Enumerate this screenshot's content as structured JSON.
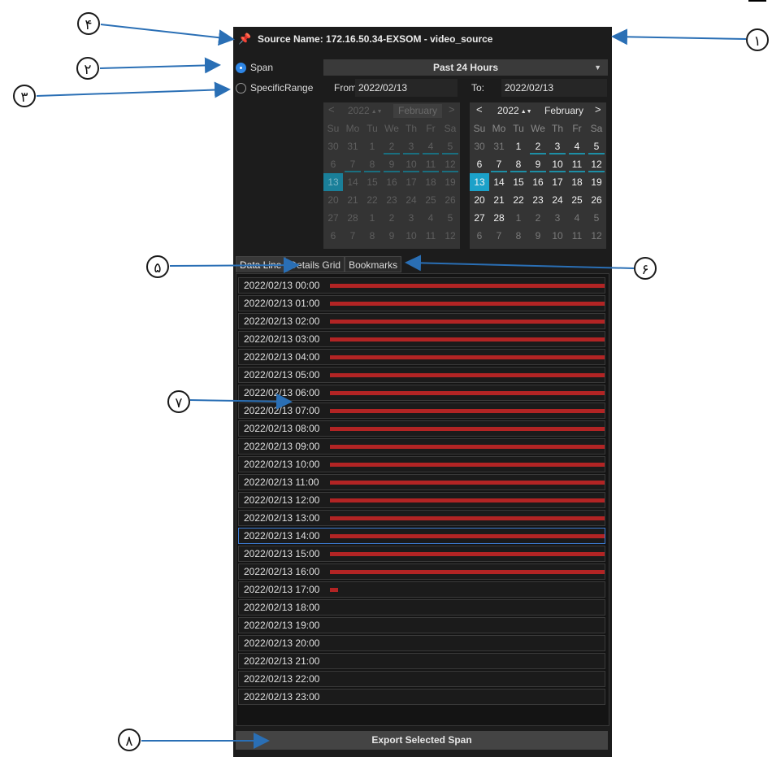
{
  "source": {
    "title": "Source Name: 172.16.50.34-EXSOM - video_source",
    "icon": "pin-icon"
  },
  "range": {
    "span_label": "Span",
    "specific_label": "SpecificRange",
    "selected": "span",
    "span_value": "Past 24 Hours",
    "from_label": "From:",
    "from_value": "2022/02/13",
    "to_label": "To:",
    "to_value": "2022/02/13"
  },
  "calendar_from": {
    "prev": "<",
    "next": ">",
    "year": "2022",
    "month": "February",
    "weekdays": [
      "Su",
      "Mo",
      "Tu",
      "We",
      "Th",
      "Fr",
      "Sa"
    ],
    "weeks": [
      [
        "30",
        "31",
        "1",
        "2",
        "3",
        "4",
        "5"
      ],
      [
        "6",
        "7",
        "8",
        "9",
        "10",
        "11",
        "12"
      ],
      [
        "13",
        "14",
        "15",
        "16",
        "17",
        "18",
        "19"
      ],
      [
        "20",
        "21",
        "22",
        "23",
        "24",
        "25",
        "26"
      ],
      [
        "27",
        "28",
        "1",
        "2",
        "3",
        "4",
        "5"
      ],
      [
        "6",
        "7",
        "8",
        "9",
        "10",
        "11",
        "12"
      ]
    ],
    "selected_day": "13"
  },
  "calendar_to": {
    "prev": "<",
    "next": ">",
    "year": "2022",
    "month": "February",
    "weekdays": [
      "Su",
      "Mo",
      "Tu",
      "We",
      "Th",
      "Fr",
      "Sa"
    ],
    "weeks": [
      [
        "30",
        "31",
        "1",
        "2",
        "3",
        "4",
        "5"
      ],
      [
        "6",
        "7",
        "8",
        "9",
        "10",
        "11",
        "12"
      ],
      [
        "13",
        "14",
        "15",
        "16",
        "17",
        "18",
        "19"
      ],
      [
        "20",
        "21",
        "22",
        "23",
        "24",
        "25",
        "26"
      ],
      [
        "27",
        "28",
        "1",
        "2",
        "3",
        "4",
        "5"
      ],
      [
        "6",
        "7",
        "8",
        "9",
        "10",
        "11",
        "12"
      ]
    ],
    "selected_day": "13"
  },
  "tabs": [
    "Data Line",
    "Details Grid",
    "Bookmarks"
  ],
  "active_tab": "Data Line",
  "data_line": [
    {
      "time": "2022/02/13 00:00",
      "fill": 1.0
    },
    {
      "time": "2022/02/13 01:00",
      "fill": 1.0
    },
    {
      "time": "2022/02/13 02:00",
      "fill": 1.0
    },
    {
      "time": "2022/02/13 03:00",
      "fill": 1.0
    },
    {
      "time": "2022/02/13 04:00",
      "fill": 1.0
    },
    {
      "time": "2022/02/13 05:00",
      "fill": 1.0
    },
    {
      "time": "2022/02/13 06:00",
      "fill": 1.0
    },
    {
      "time": "2022/02/13 07:00",
      "fill": 1.0
    },
    {
      "time": "2022/02/13 08:00",
      "fill": 1.0
    },
    {
      "time": "2022/02/13 09:00",
      "fill": 1.0
    },
    {
      "time": "2022/02/13 10:00",
      "fill": 1.0
    },
    {
      "time": "2022/02/13 11:00",
      "fill": 1.0
    },
    {
      "time": "2022/02/13 12:00",
      "fill": 1.0
    },
    {
      "time": "2022/02/13 13:00",
      "fill": 1.0
    },
    {
      "time": "2022/02/13 14:00",
      "fill": 1.0,
      "selected": true
    },
    {
      "time": "2022/02/13 15:00",
      "fill": 1.0
    },
    {
      "time": "2022/02/13 16:00",
      "fill": 1.0
    },
    {
      "time": "2022/02/13 17:00",
      "fill": 0.03
    },
    {
      "time": "2022/02/13 18:00",
      "fill": 0
    },
    {
      "time": "2022/02/13 19:00",
      "fill": 0
    },
    {
      "time": "2022/02/13 20:00",
      "fill": 0
    },
    {
      "time": "2022/02/13 21:00",
      "fill": 0
    },
    {
      "time": "2022/02/13 22:00",
      "fill": 0
    },
    {
      "time": "2022/02/13 23:00",
      "fill": 0
    }
  ],
  "export_label": "Export Selected Span",
  "callouts": [
    "١",
    "٢",
    "٣",
    "۴",
    "۵",
    "۶",
    "٧",
    "٨"
  ],
  "colors": {
    "accent": "#1ba1c9",
    "bar": "#b22424",
    "arrow": "#2a6fb5",
    "radio": "#2e86e6"
  }
}
